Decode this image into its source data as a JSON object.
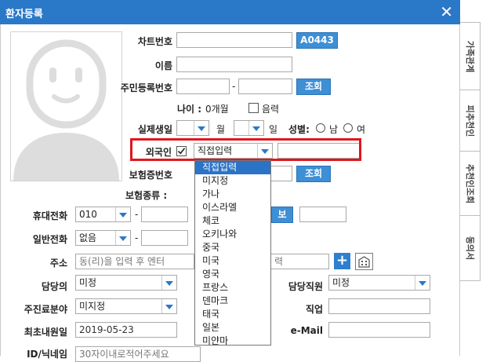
{
  "window": {
    "title": "환자등록"
  },
  "side_tabs": [
    "가족관계",
    "피추천인",
    "추천인조회",
    "동의서"
  ],
  "labels": {
    "chart_no": "차트번호",
    "name": "이름",
    "resident_no": "주민등록번호",
    "age": "나이 :",
    "lunar": "음력",
    "real_birth": "실제생일",
    "month": "월",
    "day": "일",
    "gender": "성별:",
    "male": "남",
    "female": "여",
    "foreigner": "외국인",
    "insurance_no": "보험증번호",
    "insurance_type": "보험종류 :",
    "mobile": "휴대전화",
    "phone": "일반전화",
    "address": "주소",
    "doctor": "담당의",
    "staff": "담당직원",
    "chief_area": "주진료분야",
    "job": "직업",
    "first_visit": "최초내원일",
    "email": "e-Mail",
    "id_nick": "ID/닉네임"
  },
  "values": {
    "chart_no_button": "A0443",
    "age_value": "0개월",
    "lookup_button": "조회",
    "foreigner_select": "직접입력",
    "mobile_prefix": "010",
    "phone_prefix": "없음",
    "address_placeholder": "동(리)을 입력 후 엔터",
    "address_suffix": "력",
    "doctor_select": "미정",
    "staff_select": "미정",
    "chief_select": "미지정",
    "first_visit_date": "2019-05-23",
    "id_nick_placeholder": "30자이내로적어주세요",
    "mobile_btn": "보",
    "dash": "-"
  },
  "dropdown": {
    "options": [
      "직접입력",
      "미지정",
      "가나",
      "이스라엘",
      "체코",
      "오키나와",
      "중국",
      "미국",
      "영국",
      "프랑스",
      "덴마크",
      "태국",
      "일본",
      "미얀마"
    ],
    "highlighted": 0
  },
  "colors": {
    "titlebar": "#2a78c8",
    "button": "#3d8fd6",
    "highlight_box": "#e0161e",
    "dropdown_selected": "#2b73c7"
  }
}
